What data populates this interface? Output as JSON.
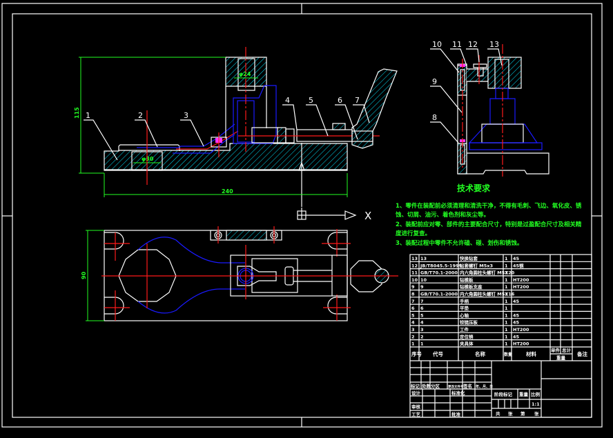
{
  "colors": {
    "background": "#000000",
    "outline": "#ffffff",
    "hidden": "#1a1aff",
    "center": "#ff1a1a",
    "dimension": "#22ff22",
    "hatch": "#00e5ff"
  },
  "front_view": {
    "part_labels": [
      "1",
      "2",
      "3",
      "4",
      "5",
      "6",
      "7"
    ],
    "dims": {
      "height": "115",
      "length": "240",
      "bore_pin": "φ30",
      "bore_bush": "φ24"
    }
  },
  "side_view": {
    "part_labels": [
      "10",
      "11",
      "12",
      "13",
      "9",
      "8"
    ]
  },
  "top_view": {
    "dims": {
      "width": "90"
    },
    "direction_mark": "X"
  },
  "tech_requirements": {
    "title": "技术要求",
    "lines": [
      "1、零件在装配前必须清理和清洗干净，不得有毛刺、飞边、氧化皮、锈",
      "蚀、切屑、油污、着色剂和灰尘等。",
      "2、装配前应对零、部件的主要配合尺寸，特别是过盈配合尺寸及相关精",
      "度进行复查。",
      "3、装配过程中零件不允许磕、碰、划伤和锈蚀。"
    ]
  },
  "parts_list": {
    "rows": [
      {
        "no": "13",
        "code": "13",
        "name": "快换钻套",
        "qty": "1",
        "material": "45"
      },
      {
        "no": "12",
        "code": "JB/T8045.5-1999",
        "name": "钻套螺钉 M5x3",
        "qty": "1",
        "material": "45钢"
      },
      {
        "no": "11",
        "code": "GB/T70.1-2000",
        "name": "内六角圆柱头螺钉 M5X20",
        "qty": "2",
        "material": ""
      },
      {
        "no": "10",
        "code": "10",
        "name": "钻模板",
        "qty": "1",
        "material": "HT200"
      },
      {
        "no": "9",
        "code": "9",
        "name": "钻模板支座",
        "qty": "1",
        "material": "HT200"
      },
      {
        "no": "8",
        "code": "GB/T70.1-2000",
        "name": "内六角圆柱头螺钉 M5X16",
        "qty": "2",
        "material": ""
      },
      {
        "no": "7",
        "code": "7",
        "name": "手柄",
        "qty": "1",
        "material": "45"
      },
      {
        "no": "6",
        "code": "6",
        "name": "平垫",
        "qty": "1",
        "material": ""
      },
      {
        "no": "5",
        "code": "5",
        "name": "心轴",
        "qty": "1",
        "material": "45"
      },
      {
        "no": "4",
        "code": "4",
        "name": "铰链压板",
        "qty": "1",
        "material": "45"
      },
      {
        "no": "3",
        "code": "3",
        "name": "工件",
        "qty": "1",
        "material": "HT200"
      },
      {
        "no": "2",
        "code": "2",
        "name": "定位销",
        "qty": "1",
        "material": "45"
      },
      {
        "no": "1",
        "code": "1",
        "name": "夹具体",
        "qty": "1",
        "material": "HT200"
      }
    ],
    "header": {
      "no": "序号",
      "code": "代号",
      "name": "名称",
      "qty": "数量",
      "material": "材料",
      "single": "单件",
      "total": "总计",
      "weight": "重量",
      "remark": "备注"
    }
  },
  "title_block": {
    "revision": [
      "标记",
      "处数",
      "分区",
      "更改文件号",
      "签名",
      "年、月、日"
    ],
    "design": "设计",
    "standardize": "标准化",
    "review": "审核",
    "process": "工艺",
    "approve": "批准",
    "stage": "阶段标记",
    "weight": "重量",
    "scale_label": "比例",
    "scale": "1:1",
    "sheets": [
      "共",
      "张",
      "第",
      "张"
    ]
  }
}
